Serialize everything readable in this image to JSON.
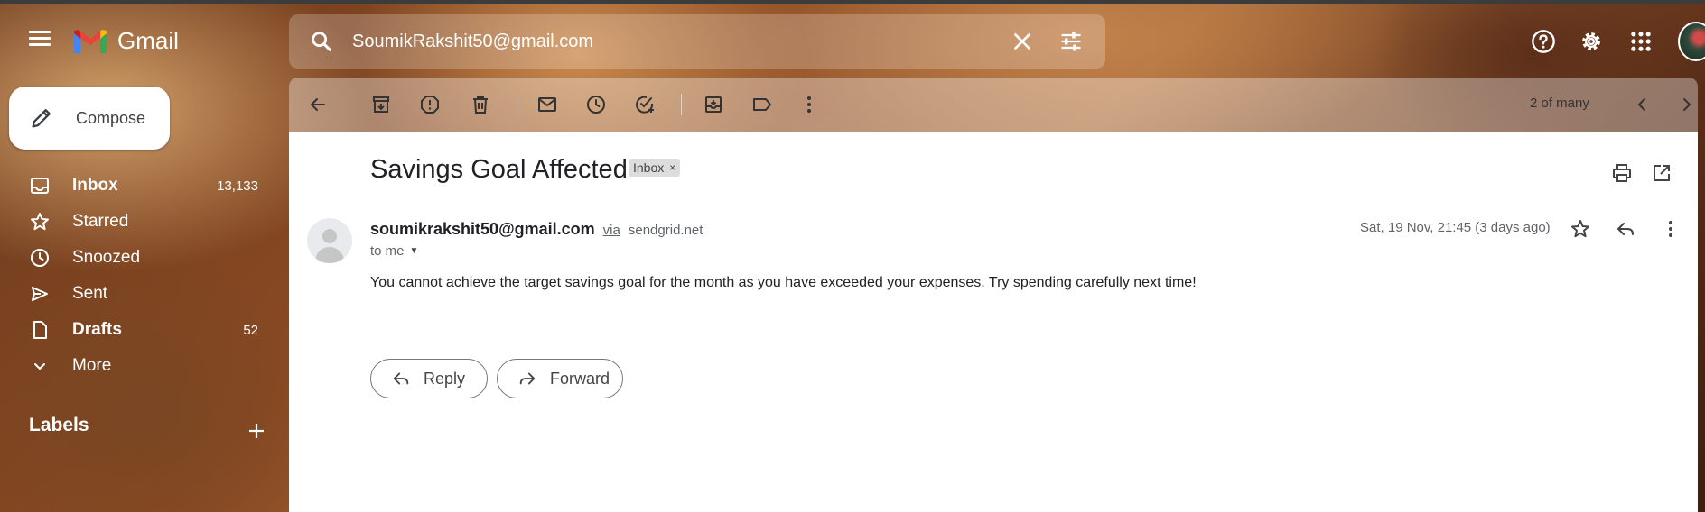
{
  "header": {
    "app_name": "Gmail",
    "search_value": "SoumikRakshit50@gmail.com",
    "icons": [
      "menu-icon",
      "gmail-logo",
      "search-icon",
      "clear-icon",
      "search-options-icon",
      "help-icon",
      "settings-icon",
      "apps-icon",
      "account-avatar"
    ]
  },
  "sidebar": {
    "compose_label": "Compose",
    "items": [
      {
        "label": "Inbox",
        "count": "13,133",
        "icon": "inbox-icon",
        "bold": true
      },
      {
        "label": "Starred",
        "count": "",
        "icon": "star-icon",
        "bold": false
      },
      {
        "label": "Snoozed",
        "count": "",
        "icon": "clock-icon",
        "bold": false
      },
      {
        "label": "Sent",
        "count": "",
        "icon": "send-icon",
        "bold": false
      },
      {
        "label": "Drafts",
        "count": "52",
        "icon": "draft-icon",
        "bold": true
      },
      {
        "label": "More",
        "count": "",
        "icon": "chevron-down-icon",
        "bold": false
      }
    ],
    "labels_title": "Labels"
  },
  "toolbar": {
    "pager_text": "2 of many"
  },
  "email": {
    "subject": "Savings Goal Affected",
    "label_badge": "Inbox",
    "label_badge_close": "×",
    "sender_email": "soumikrakshit50@gmail.com",
    "via_text": "via",
    "via_domain": "sendgrid.net",
    "to_text": "to me",
    "date": "Sat, 19 Nov, 21:45 (3 days ago)",
    "body": "You cannot achieve the target savings goal for the month as you have exceeded your expenses. Try spending carefully next time!",
    "reply_label": "Reply",
    "forward_label": "Forward"
  },
  "colors": {
    "accent": "#ffffff",
    "panel_bg": "#ffffff",
    "text_primary": "#202124",
    "text_secondary": "#5f6368"
  }
}
